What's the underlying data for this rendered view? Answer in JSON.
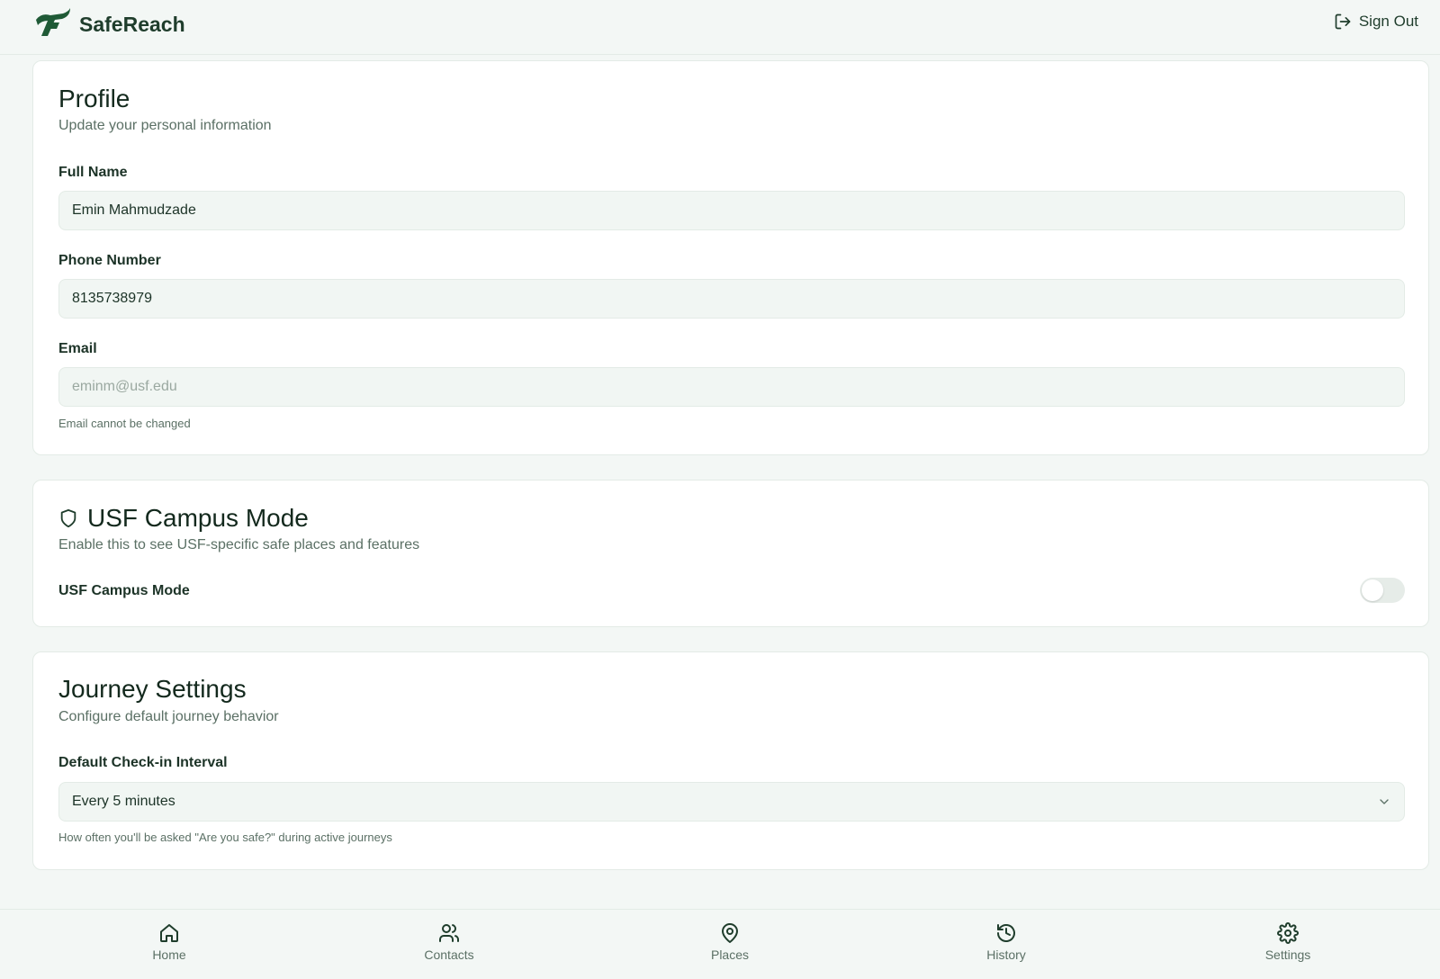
{
  "header": {
    "app_name": "SafeReach",
    "signout_label": "Sign Out"
  },
  "profile": {
    "title": "Profile",
    "subtitle": "Update your personal information",
    "full_name_label": "Full Name",
    "full_name_value": "Emin Mahmudzade",
    "phone_label": "Phone Number",
    "phone_value": "8135738979",
    "email_label": "Email",
    "email_value": "eminm@usf.edu",
    "email_hint": "Email cannot be changed"
  },
  "campus": {
    "title": "USF Campus Mode",
    "subtitle": "Enable this to see USF-specific safe places and features",
    "toggle_label": "USF Campus Mode",
    "enabled": false
  },
  "journey": {
    "title": "Journey Settings",
    "subtitle": "Configure default journey behavior",
    "interval_label": "Default Check-in Interval",
    "interval_selected": "Every 5 minutes",
    "interval_hint": "How often you'll be asked \"Are you safe?\" during active journeys"
  },
  "nav": {
    "items": [
      {
        "label": "Home",
        "icon": "home-icon"
      },
      {
        "label": "Contacts",
        "icon": "users-icon"
      },
      {
        "label": "Places",
        "icon": "map-pin-icon"
      },
      {
        "label": "History",
        "icon": "history-icon"
      },
      {
        "label": "Settings",
        "icon": "gear-icon",
        "active": true
      }
    ]
  },
  "colors": {
    "brand": "#1f3d2c",
    "background": "#f3f7f5",
    "card": "#ffffff",
    "muted": "#5b7065"
  }
}
